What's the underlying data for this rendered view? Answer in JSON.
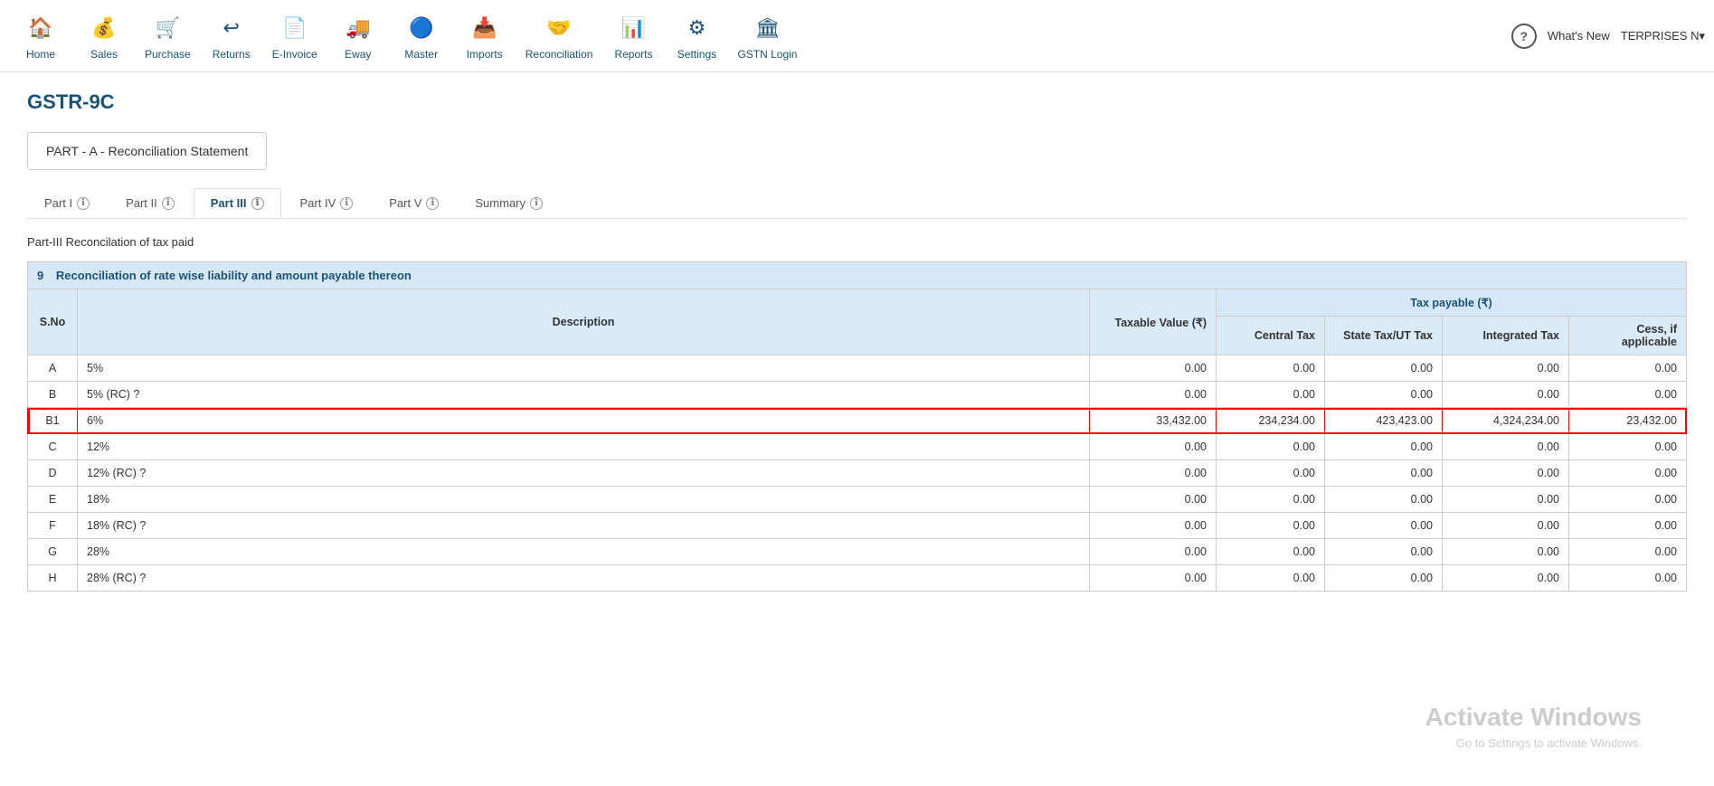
{
  "app": {
    "title": "GSTR-9C",
    "part_label": "PART - A - Reconciliation Statement",
    "section_heading": "Part-III Reconcilation of tax paid",
    "watermark_title": "Activate Windows",
    "watermark_sub": "Go to Settings to activate Windows."
  },
  "navbar": {
    "items": [
      {
        "id": "home",
        "label": "Home",
        "icon": "🏠"
      },
      {
        "id": "sales",
        "label": "Sales",
        "icon": "💰"
      },
      {
        "id": "purchase",
        "label": "Purchase",
        "icon": "🛒"
      },
      {
        "id": "returns",
        "label": "Returns",
        "icon": "↩"
      },
      {
        "id": "einvoice",
        "label": "E-Invoice",
        "icon": "📄"
      },
      {
        "id": "eway",
        "label": "Eway",
        "icon": "🚚"
      },
      {
        "id": "master",
        "label": "Master",
        "icon": "🔵"
      },
      {
        "id": "imports",
        "label": "Imports",
        "icon": "📥"
      },
      {
        "id": "reconciliation",
        "label": "Reconciliation",
        "icon": "🤝"
      },
      {
        "id": "reports",
        "label": "Reports",
        "icon": "📊"
      },
      {
        "id": "settings",
        "label": "Settings",
        "icon": "⚙"
      },
      {
        "id": "gstn",
        "label": "GSTN Login",
        "icon": "🏛"
      }
    ],
    "help_tooltip": "?",
    "whats_new": "What's New",
    "enterprise": "TERPRISES N▾"
  },
  "tabs": [
    {
      "id": "part1",
      "label": "Part I",
      "active": false
    },
    {
      "id": "part2",
      "label": "Part II",
      "active": false
    },
    {
      "id": "part3",
      "label": "Part III",
      "active": true
    },
    {
      "id": "part4",
      "label": "Part IV",
      "active": false
    },
    {
      "id": "part5",
      "label": "Part V",
      "active": false
    },
    {
      "id": "summary",
      "label": "Summary",
      "active": false
    }
  ],
  "table": {
    "section_number": "9",
    "section_title": "Reconciliation of rate wise liability and amount payable thereon",
    "headers": {
      "sno": "S.No",
      "description": "Description",
      "taxable_value": "Taxable Value (₹)",
      "tax_payable": "Tax payable (₹)",
      "central_tax": "Central Tax",
      "state_tax": "State Tax/UT Tax",
      "integrated_tax": "Integrated Tax",
      "cess": "Cess, if applicable"
    },
    "rows": [
      {
        "sno": "A",
        "desc": "5%",
        "taxable": "0.00",
        "central": "0.00",
        "state": "0.00",
        "integrated": "0.00",
        "cess": "0.00",
        "highlight": false
      },
      {
        "sno": "B",
        "desc": "5% (RC) ?",
        "taxable": "0.00",
        "central": "0.00",
        "state": "0.00",
        "integrated": "0.00",
        "cess": "0.00",
        "highlight": false
      },
      {
        "sno": "B1",
        "desc": "6%",
        "taxable": "33,432.00",
        "central": "234,234.00",
        "state": "423,423.00",
        "integrated": "4,324,234.00",
        "cess": "23,432.00",
        "highlight": true
      },
      {
        "sno": "C",
        "desc": "12%",
        "taxable": "0.00",
        "central": "0.00",
        "state": "0.00",
        "integrated": "0.00",
        "cess": "0.00",
        "highlight": false
      },
      {
        "sno": "D",
        "desc": "12% (RC) ?",
        "taxable": "0.00",
        "central": "0.00",
        "state": "0.00",
        "integrated": "0.00",
        "cess": "0.00",
        "highlight": false
      },
      {
        "sno": "E",
        "desc": "18%",
        "taxable": "0.00",
        "central": "0.00",
        "state": "0.00",
        "integrated": "0.00",
        "cess": "0.00",
        "highlight": false
      },
      {
        "sno": "F",
        "desc": "18% (RC) ?",
        "taxable": "0.00",
        "central": "0.00",
        "state": "0.00",
        "integrated": "0.00",
        "cess": "0.00",
        "highlight": false
      },
      {
        "sno": "G",
        "desc": "28%",
        "taxable": "0.00",
        "central": "0.00",
        "state": "0.00",
        "integrated": "0.00",
        "cess": "0.00",
        "highlight": false
      },
      {
        "sno": "H",
        "desc": "28% (RC) ?",
        "taxable": "0.00",
        "central": "0.00",
        "state": "0.00",
        "integrated": "0.00",
        "cess": "0.00",
        "highlight": false
      }
    ]
  }
}
